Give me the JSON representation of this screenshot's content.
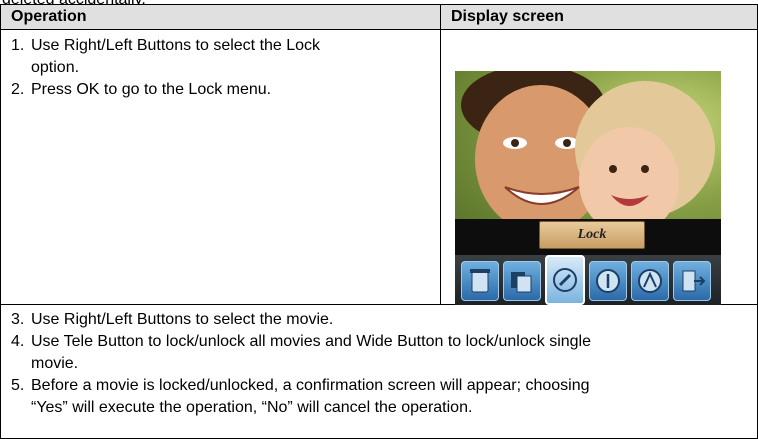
{
  "intro_cut": "deleted accidentally.",
  "table": {
    "header_operation": "Operation",
    "header_display": "Display screen"
  },
  "steps_a": [
    {
      "num": "1.",
      "text": "Use Right/Left Buttons to select the Lock"
    },
    {
      "num": "",
      "text": "option."
    },
    {
      "num": "2.",
      "text": "Press OK to go to the Lock menu."
    }
  ],
  "steps_b": [
    {
      "num": "3.",
      "text": "Use Right/Left Buttons to select the movie."
    },
    {
      "num": "4.",
      "text": "Use Tele Button to lock/unlock all movies and Wide Button to lock/unlock single"
    },
    {
      "num": "",
      "text": "movie."
    },
    {
      "num": "5.",
      "text": "Before a movie is locked/unlocked, a confirmation screen will appear; choosing"
    },
    {
      "num": "",
      "text": "“Yes” will execute the operation, “No” will cancel the operation."
    }
  ],
  "screen": {
    "lock_label": "Lock",
    "menu_icons": [
      "trash-icon",
      "slideshow-icon",
      "lock-icon",
      "protect-one-icon",
      "protect-all-icon",
      "exit-icon"
    ],
    "selected_icon": "lock-icon",
    "colors": {
      "icon_blue": "#2b6aa8",
      "label_tan": "#d9b47f",
      "bar_dark": "#1d2226"
    }
  }
}
